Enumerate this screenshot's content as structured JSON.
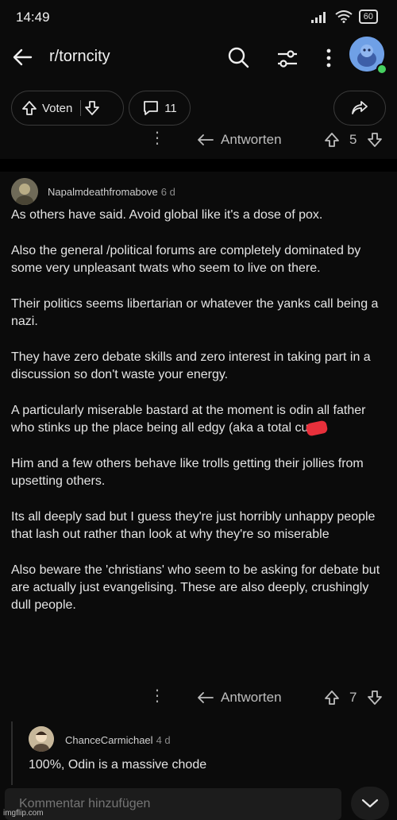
{
  "status": {
    "time": "14:49",
    "battery": "60"
  },
  "header": {
    "subreddit": "r/torncity"
  },
  "post_actions": {
    "vote_label": "Voten",
    "comment_count": "11"
  },
  "reply_label": "Antworten",
  "top_reply_row": {
    "score": "5"
  },
  "comment": {
    "user": "Napalmdeathfromabove",
    "age": "6 d",
    "paragraphs": [
      "As others have said. Avoid global like it's a dose of pox.",
      "Also the general /political forums are completely dominated by some very unpleasant twats who seem to live on there.",
      "Their politics seems libertarian or whatever the yanks call being a nazi.",
      "They have zero debate skills and zero interest in taking part in a discussion so don't waste your energy.",
      "A particularly miserable bastard at the moment is odin all father who stinks up the place being all edgy (aka a total cu",
      "Him and a few others behave like trolls getting their jollies from upsetting others.",
      "Its all deeply sad but I guess they're just horribly unhappy people that lash out rather than look at why they're so miserable",
      "Also beware the 'christians' who seem to be asking for debate but are actually just evangelising. These are also deeply, crushingly dull people."
    ],
    "score": "7"
  },
  "reply": {
    "user": "ChanceCarmichael",
    "age": "4 d",
    "text": "100%, Odin is a massive chode"
  },
  "composer": {
    "placeholder": "Kommentar hinzufügen"
  },
  "watermark": "imgflip.com",
  "colors": {
    "redaction": "#e8303b",
    "background": "#0b0b0b",
    "online_dot": "#46d160"
  }
}
